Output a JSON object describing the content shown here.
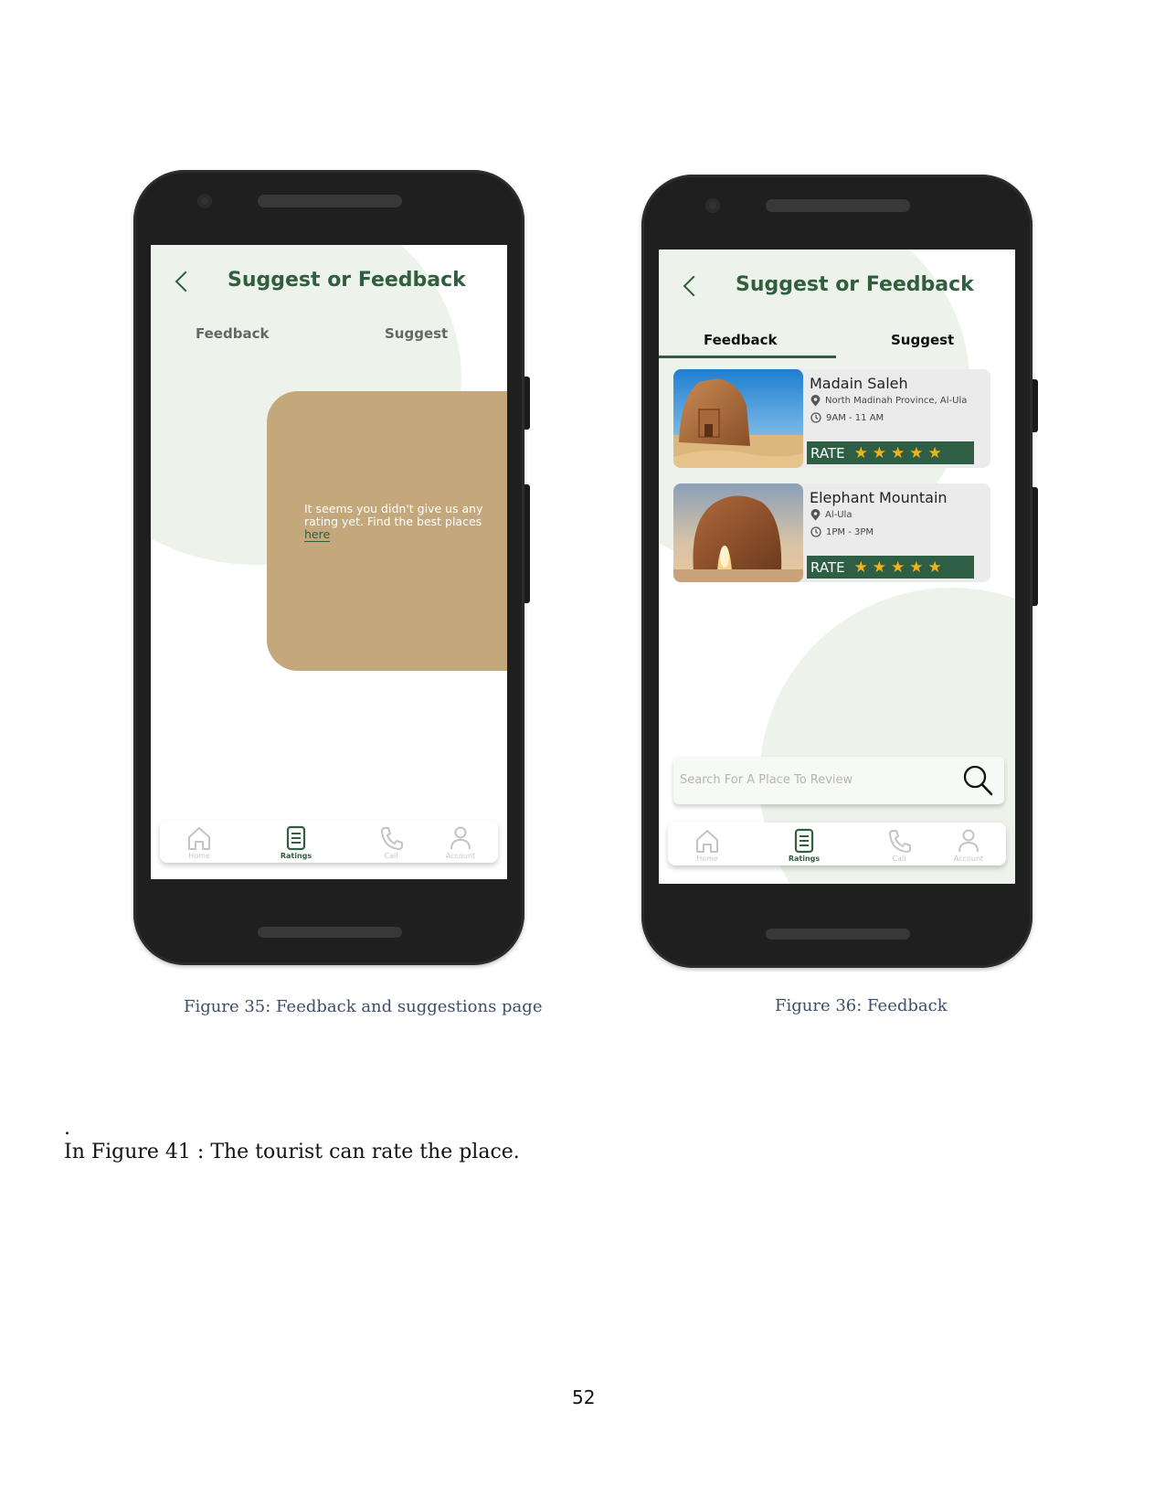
{
  "phone1": {
    "title": "Suggest or Feedback",
    "tabs": [
      {
        "label": "Feedback",
        "color": "#666666"
      },
      {
        "label": "Suggest",
        "color": "#666666"
      }
    ],
    "empty_state": {
      "message": "It seems you didn't give us any rating yet. Find the best places ",
      "link": "here"
    }
  },
  "phone2": {
    "title": "Suggest or Feedback",
    "tabs": [
      {
        "label": "Feedback",
        "active": true
      },
      {
        "label": "Suggest",
        "active": false
      }
    ],
    "places": [
      {
        "name": "Madain Saleh",
        "location": "North Madinah Province, Al-Ula",
        "hours": "9AM - 11 AM",
        "rate_label": "RATE",
        "stars": "★★★★★",
        "rating": 5
      },
      {
        "name": "Elephant Mountain",
        "location": "Al-Ula",
        "hours": "1PM - 3PM",
        "rate_label": "RATE",
        "stars": "★★★★★",
        "rating": 5
      }
    ],
    "search": {
      "placeholder": "Search For A Place To Review"
    }
  },
  "nav": [
    {
      "label": "Home",
      "icon": "home-icon"
    },
    {
      "label": "Ratings",
      "icon": "ratings-icon",
      "active": true
    },
    {
      "label": "Call",
      "icon": "phone-icon"
    },
    {
      "label": "Account",
      "icon": "account-icon"
    }
  ],
  "captions": {
    "fig35": "Figure 35: Feedback and suggestions page",
    "fig36": "Figure 36: Feedback"
  },
  "body": {
    "dot": ".",
    "text": "In Figure 41 : The tourist can rate the place."
  },
  "page_number": "52",
  "colors": {
    "brand_green": "#2f5f3f",
    "rate_bar": "#2e5e43",
    "star": "#f1b21b",
    "card_tan": "#c4a77a"
  }
}
